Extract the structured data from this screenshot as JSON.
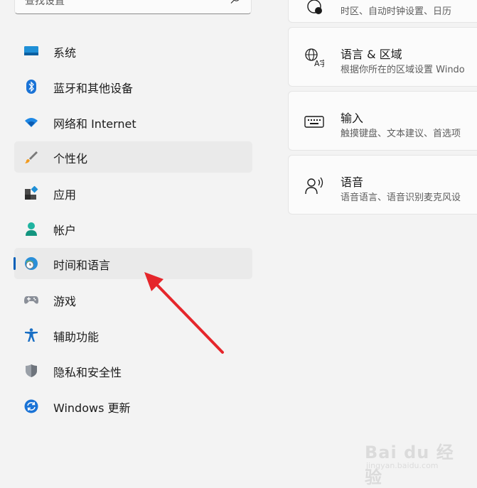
{
  "search": {
    "placeholder": "查找设置"
  },
  "sidebar": {
    "items": [
      {
        "label": "系统",
        "icon": "system-display-icon"
      },
      {
        "label": "蓝牙和其他设备",
        "icon": "bluetooth-icon"
      },
      {
        "label": "网络和 Internet",
        "icon": "wifi-icon"
      },
      {
        "label": "个性化",
        "icon": "brush-icon"
      },
      {
        "label": "应用",
        "icon": "apps-icon"
      },
      {
        "label": "帐户",
        "icon": "account-icon"
      },
      {
        "label": "时间和语言",
        "icon": "globe-clock-icon",
        "selected": true
      },
      {
        "label": "游戏",
        "icon": "gamepad-icon"
      },
      {
        "label": "辅助功能",
        "icon": "accessibility-icon"
      },
      {
        "label": "隐私和安全性",
        "icon": "shield-icon"
      },
      {
        "label": "Windows 更新",
        "icon": "update-icon"
      }
    ]
  },
  "cards": [
    {
      "title": "",
      "subtitle": "时区、自动时钟设置、日历",
      "icon": "clock-icon"
    },
    {
      "title": "语言 & 区域",
      "subtitle": "根据你所在的区域设置 Windo",
      "icon": "language-icon"
    },
    {
      "title": "输入",
      "subtitle": "触摸键盘、文本建议、首选项",
      "icon": "keyboard-icon"
    },
    {
      "title": "语音",
      "subtitle": "语音语言、语音识别麦克风设",
      "icon": "speech-icon"
    }
  ],
  "watermark": {
    "line1": "Bai du 经验",
    "line2": "jingyan.baidu.com"
  },
  "colors": {
    "accent": "#005fb8",
    "arrow": "#e5262b",
    "background": "#f3f3f3"
  }
}
